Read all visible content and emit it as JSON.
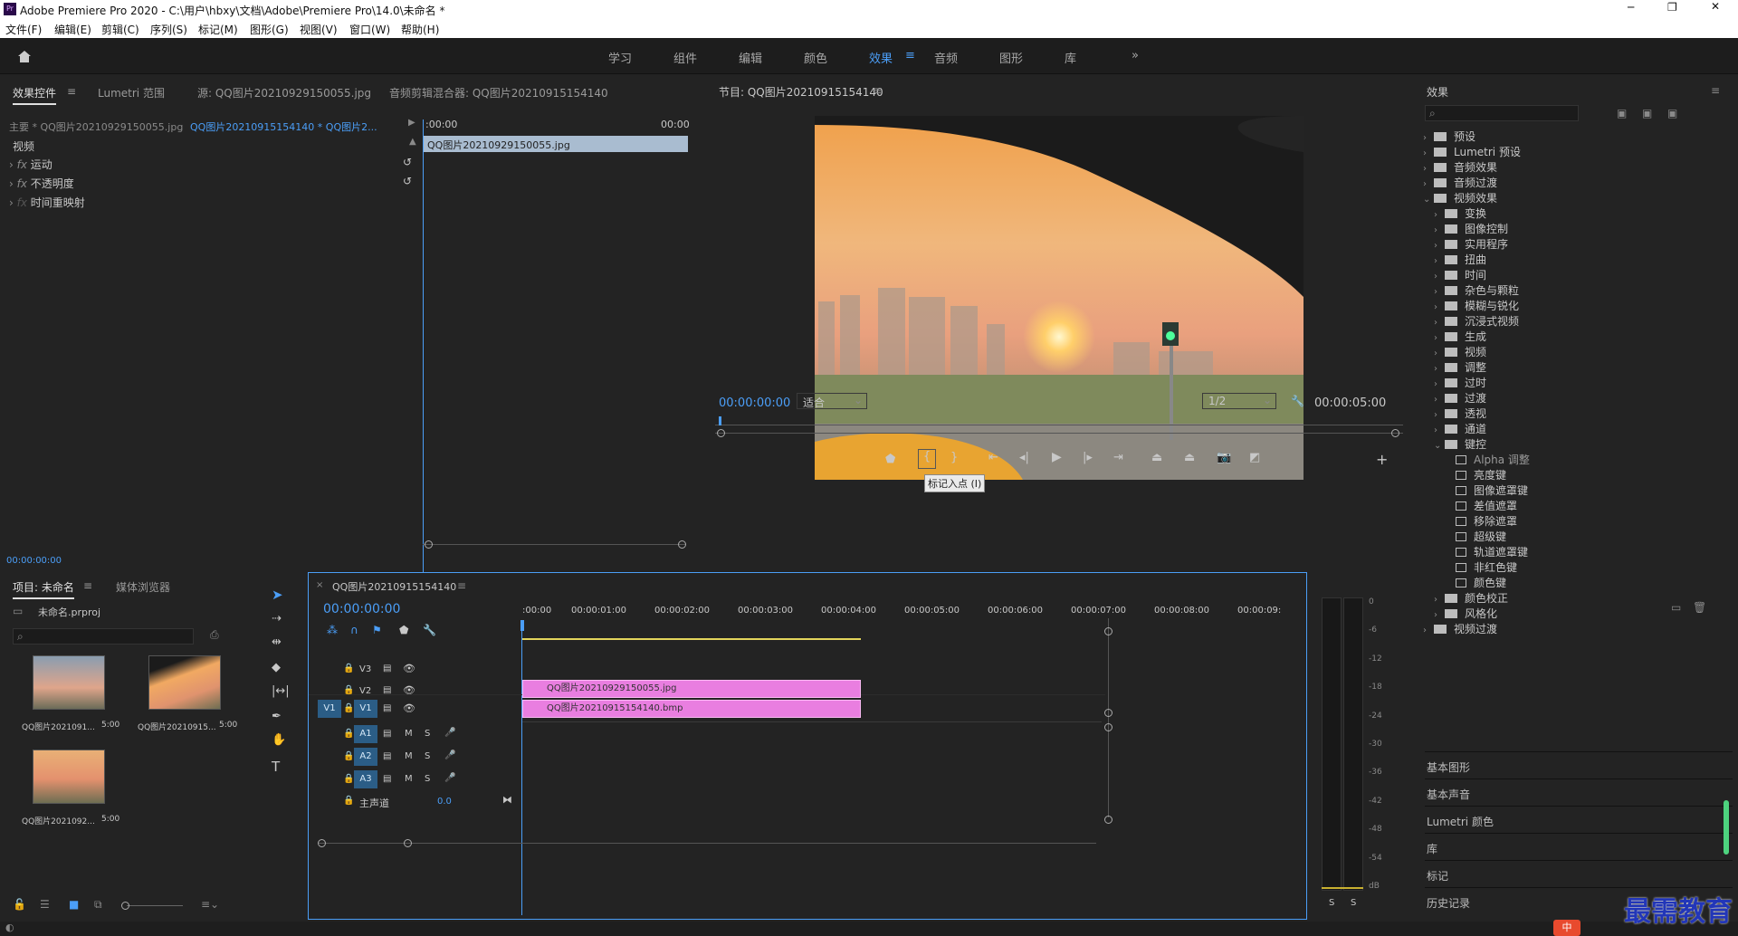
{
  "titlebar": {
    "logo": "Pr",
    "title": "Adobe Premiere Pro 2020 - C:\\用户\\hbxy\\文档\\Adobe\\Premiere Pro\\14.0\\未命名 *"
  },
  "menu": [
    "文件(F)",
    "编辑(E)",
    "剪辑(C)",
    "序列(S)",
    "标记(M)",
    "图形(G)",
    "视图(V)",
    "窗口(W)",
    "帮助(H)"
  ],
  "workspaces": [
    "学习",
    "组件",
    "编辑",
    "颜色",
    "效果",
    "音频",
    "图形",
    "库"
  ],
  "active_workspace": "效果",
  "source_panel": {
    "tabs": [
      "效果控件",
      "Lumetri 范围",
      "源: QQ图片20210929150055.jpg",
      "音频剪辑混合器: QQ图片20210915154140"
    ],
    "master": "主要 * QQ图片20210929150055.jpg",
    "sequence_clip": "QQ图片20210915154140 * QQ图片2...",
    "tc_start": ":00:00",
    "tc_end": "00:00",
    "clip_bar": "QQ图片20210929150055.jpg",
    "section": "视频",
    "effects": [
      "运动",
      "不透明度",
      "时间重映射"
    ],
    "timecode": "00:00:00:00"
  },
  "program": {
    "title": "节目: QQ图片20210915154140",
    "timecode": "00:00:00:00",
    "fit": "适合",
    "quality": "1/2",
    "duration": "00:00:05:00",
    "tooltip": "标记入点 (I)"
  },
  "effects_panel": {
    "title": "效果",
    "tree": [
      {
        "label": "预设",
        "type": "folder",
        "indent": 0,
        "open": false
      },
      {
        "label": "Lumetri 预设",
        "type": "folder",
        "indent": 0,
        "open": false
      },
      {
        "label": "音频效果",
        "type": "folder",
        "indent": 0,
        "open": false
      },
      {
        "label": "音频过渡",
        "type": "folder",
        "indent": 0,
        "open": false
      },
      {
        "label": "视频效果",
        "type": "folder",
        "indent": 0,
        "open": true
      },
      {
        "label": "变换",
        "type": "folder",
        "indent": 1,
        "open": false
      },
      {
        "label": "图像控制",
        "type": "folder",
        "indent": 1,
        "open": false
      },
      {
        "label": "实用程序",
        "type": "folder",
        "indent": 1,
        "open": false
      },
      {
        "label": "扭曲",
        "type": "folder",
        "indent": 1,
        "open": false
      },
      {
        "label": "时间",
        "type": "folder",
        "indent": 1,
        "open": false
      },
      {
        "label": "杂色与颗粒",
        "type": "folder",
        "indent": 1,
        "open": false
      },
      {
        "label": "模糊与锐化",
        "type": "folder",
        "indent": 1,
        "open": false
      },
      {
        "label": "沉浸式视频",
        "type": "folder",
        "indent": 1,
        "open": false
      },
      {
        "label": "生成",
        "type": "folder",
        "indent": 1,
        "open": false
      },
      {
        "label": "视频",
        "type": "folder",
        "indent": 1,
        "open": false
      },
      {
        "label": "调整",
        "type": "folder",
        "indent": 1,
        "open": false
      },
      {
        "label": "过时",
        "type": "folder",
        "indent": 1,
        "open": false
      },
      {
        "label": "过渡",
        "type": "folder",
        "indent": 1,
        "open": false
      },
      {
        "label": "透视",
        "type": "folder",
        "indent": 1,
        "open": false
      },
      {
        "label": "通道",
        "type": "folder",
        "indent": 1,
        "open": false
      },
      {
        "label": "键控",
        "type": "folder",
        "indent": 1,
        "open": true
      },
      {
        "label": "Alpha 调整",
        "type": "preset",
        "indent": 2,
        "selected": true
      },
      {
        "label": "亮度键",
        "type": "preset",
        "indent": 2
      },
      {
        "label": "图像遮罩键",
        "type": "preset",
        "indent": 2
      },
      {
        "label": "差值遮罩",
        "type": "preset",
        "indent": 2
      },
      {
        "label": "移除遮罩",
        "type": "preset",
        "indent": 2
      },
      {
        "label": "超级键",
        "type": "preset",
        "indent": 2
      },
      {
        "label": "轨道遮罩键",
        "type": "preset",
        "indent": 2
      },
      {
        "label": "非红色键",
        "type": "preset",
        "indent": 2
      },
      {
        "label": "颜色键",
        "type": "preset",
        "indent": 2
      },
      {
        "label": "颜色校正",
        "type": "folder",
        "indent": 1,
        "open": false
      },
      {
        "label": "风格化",
        "type": "folder",
        "indent": 1,
        "open": false
      },
      {
        "label": "视频过渡",
        "type": "folder",
        "indent": 0,
        "open": false
      }
    ],
    "side_panels": [
      "基本图形",
      "基本声音",
      "Lumetri 颜色",
      "库",
      "标记",
      "历史记录"
    ]
  },
  "project": {
    "tabs": [
      "项目: 未命名",
      "媒体浏览器"
    ],
    "file": "未命名.prproj",
    "items": [
      {
        "name": "QQ图片2021091...",
        "dur": "5:00"
      },
      {
        "name": "QQ图片20210915...",
        "dur": "5:00"
      },
      {
        "name": "QQ图片2021092...",
        "dur": "5:00"
      }
    ]
  },
  "timeline": {
    "title": "QQ图片20210915154140",
    "timecode": "00:00:00:00",
    "ruler": [
      ":00:00",
      "00:00:01:00",
      "00:00:02:00",
      "00:00:03:00",
      "00:00:04:00",
      "00:00:05:00",
      "00:00:06:00",
      "00:00:07:00",
      "00:00:08:00",
      "00:00:09:"
    ],
    "video_tracks": [
      "V3",
      "V2",
      "V1"
    ],
    "audio_tracks": [
      "A1",
      "A2",
      "A3"
    ],
    "src_v": "V1",
    "master": "主声道",
    "master_val": "0.0",
    "m": "M",
    "s": "S",
    "clips": [
      {
        "track": "V2",
        "name": "QQ图片20210929150055.jpg"
      },
      {
        "track": "V1",
        "name": "QQ图片20210915154140.bmp"
      }
    ]
  },
  "meter": {
    "scale": [
      "0",
      "-6",
      "-12",
      "-18",
      "-24",
      "-30",
      "-36",
      "-42",
      "-48",
      "-54",
      "dB"
    ],
    "solo": [
      "S",
      "S"
    ]
  },
  "watermark": "最需教育",
  "ime": "中"
}
